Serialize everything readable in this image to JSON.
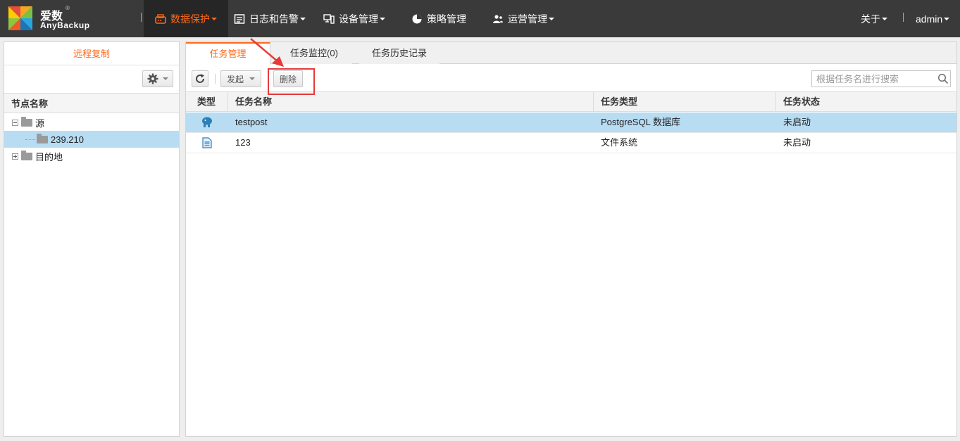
{
  "brand": {
    "name_cn": "爱数",
    "reg": "®",
    "name_en": "AnyBackup"
  },
  "nav": {
    "items": [
      {
        "label": "数据保护",
        "icon": "data-protection-icon",
        "dropdown": true,
        "active": true
      },
      {
        "label": "日志和告警",
        "icon": "log-alert-icon",
        "dropdown": true
      },
      {
        "label": "设备管理",
        "icon": "device-icon",
        "dropdown": true
      },
      {
        "label": "策略管理",
        "icon": "policy-pie-icon",
        "dropdown": false
      },
      {
        "label": "运营管理",
        "icon": "users-icon",
        "dropdown": true
      }
    ],
    "about": "关于",
    "user": "admin"
  },
  "left": {
    "title": "远程复制",
    "column_header": "节点名称",
    "tree": [
      {
        "label": "源",
        "level": 0,
        "expanded": true
      },
      {
        "label": "239.210",
        "level": 1,
        "selected": true
      },
      {
        "label": "目的地",
        "level": 0,
        "expanded": false
      }
    ]
  },
  "tabs": [
    {
      "label": "任务管理",
      "active": true
    },
    {
      "label": "任务监控(0)"
    },
    {
      "label": "任务历史记录"
    }
  ],
  "toolbar": {
    "launch_label": "发起",
    "delete_label": "删除",
    "search_placeholder": "根据任务名进行搜索"
  },
  "table": {
    "headers": {
      "type": "类型",
      "name": "任务名称",
      "task_type": "任务类型",
      "status": "任务状态"
    },
    "rows": [
      {
        "icon": "postgresql-elephant-icon",
        "name": "testpost",
        "task_type": "PostgreSQL 数据库",
        "status": "未启动",
        "selected": true
      },
      {
        "icon": "file-document-icon",
        "name": "123",
        "task_type": "文件系统",
        "status": "未启动"
      }
    ]
  },
  "colors": {
    "accent": "#ff6a1a",
    "selection": "#b8dcf2",
    "topbar": "#3a3a3a",
    "annotation": "#e83a3a"
  }
}
